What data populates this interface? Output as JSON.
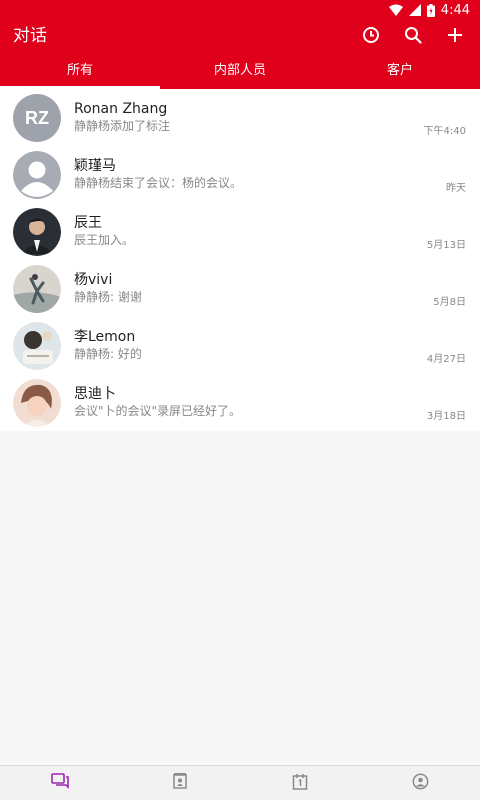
{
  "status": {
    "time": "4:44"
  },
  "header": {
    "title": "对话"
  },
  "tabs": [
    {
      "label": "所有",
      "active": true
    },
    {
      "label": "内部人员",
      "active": false
    },
    {
      "label": "客户",
      "active": false
    }
  ],
  "conversations": [
    {
      "name": "Ronan Zhang",
      "initials": "RZ",
      "message": "静静杨添加了标注",
      "time": "下午4:40"
    },
    {
      "name": "颖瑾马",
      "message": "静静杨结束了会议：杨的会议。",
      "time": "昨天"
    },
    {
      "name": "辰王",
      "message": "辰王加入。",
      "time": "5月13日"
    },
    {
      "name": "杨vivi",
      "message": "静静杨: 谢谢",
      "time": "5月8日"
    },
    {
      "name": "李Lemon",
      "message": "静静杨: 好的",
      "time": "4月27日"
    },
    {
      "name": "思迪卜",
      "message": "会议\"卜的会议\"录屏已经好了。",
      "time": "3月18日"
    }
  ],
  "colors": {
    "accent": "#e0001b",
    "active_nav": "#9c27b0",
    "inactive_nav": "#8a8a8a"
  },
  "bottom_nav": [
    {
      "icon": "chat-icon",
      "active": true
    },
    {
      "icon": "contacts-icon",
      "active": false
    },
    {
      "icon": "calendar-icon",
      "active": false
    },
    {
      "icon": "profile-icon",
      "active": false
    }
  ]
}
